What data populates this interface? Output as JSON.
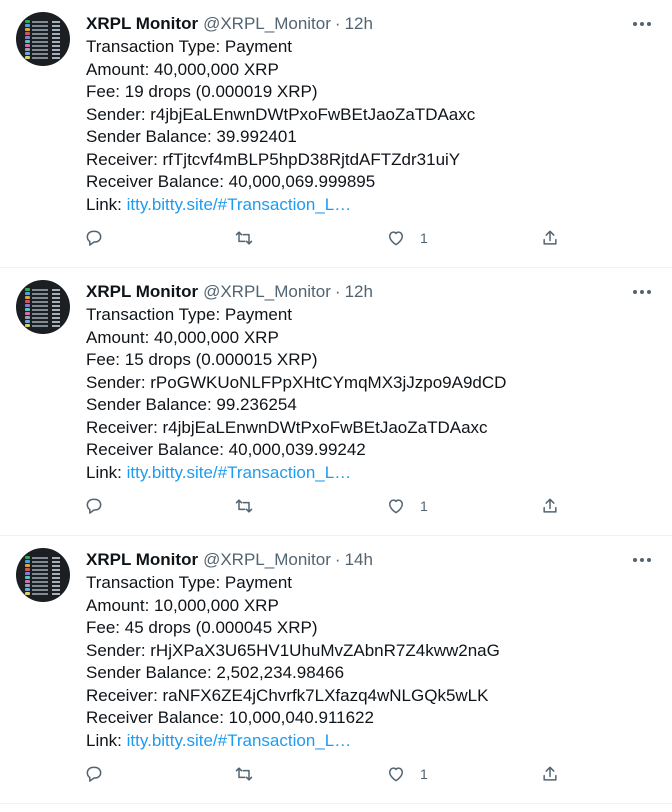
{
  "tweets": [
    {
      "name": "XRPL Monitor",
      "handle": "@XRPL_Monitor",
      "separator": "·",
      "time": "12h",
      "lines": [
        "Transaction Type: Payment",
        "Amount: 40,000,000 XRP",
        "Fee: 19 drops (0.000019 XRP)",
        "Sender: r4jbjEaLEnwnDWtPxoFwBEtJaoZaTDAaxc",
        "Sender Balance: 39.992401",
        "Receiver: rfTjtcvf4mBLP5hpD38RjtdAFTZdr31uiY",
        "Receiver Balance: 40,000,069.999895"
      ],
      "link_label": "Link: ",
      "link_text": "itty.bitty.site/#Transaction_L…",
      "likes": "1"
    },
    {
      "name": "XRPL Monitor",
      "handle": "@XRPL_Monitor",
      "separator": "·",
      "time": "12h",
      "lines": [
        "Transaction Type: Payment",
        "Amount: 40,000,000 XRP",
        "Fee: 15 drops (0.000015 XRP)",
        "Sender: rPoGWKUoNLFPpXHtCYmqMX3jJzpo9A9dCD",
        "Sender Balance: 99.236254",
        "Receiver: r4jbjEaLEnwnDWtPxoFwBEtJaoZaTDAaxc",
        "Receiver Balance: 40,000,039.99242"
      ],
      "link_label": "Link: ",
      "link_text": "itty.bitty.site/#Transaction_L…",
      "likes": "1"
    },
    {
      "name": "XRPL Monitor",
      "handle": "@XRPL_Monitor",
      "separator": "·",
      "time": "14h",
      "lines": [
        "Transaction Type: Payment",
        "Amount: 10,000,000 XRP",
        "Fee: 45 drops (0.000045 XRP)",
        "Sender: rHjXPaX3U65HV1UhuMvZAbnR7Z4kww2naG",
        "Sender Balance: 2,502,234.98466",
        "Receiver: raNFX6ZE4jChvrfk7LXfazq4wNLGQk5wLK",
        "Receiver Balance: 10,000,040.911622"
      ],
      "link_label": "Link: ",
      "link_text": "itty.bitty.site/#Transaction_L…",
      "likes": "1"
    }
  ],
  "icons": {
    "reply": "reply-icon",
    "retweet": "retweet-icon",
    "like": "like-icon",
    "share": "share-icon",
    "more": "more-icon"
  },
  "colors": {
    "link": "#1d9bf0",
    "muted": "#536471",
    "text": "#0f1419",
    "divider": "#eff3f4"
  }
}
